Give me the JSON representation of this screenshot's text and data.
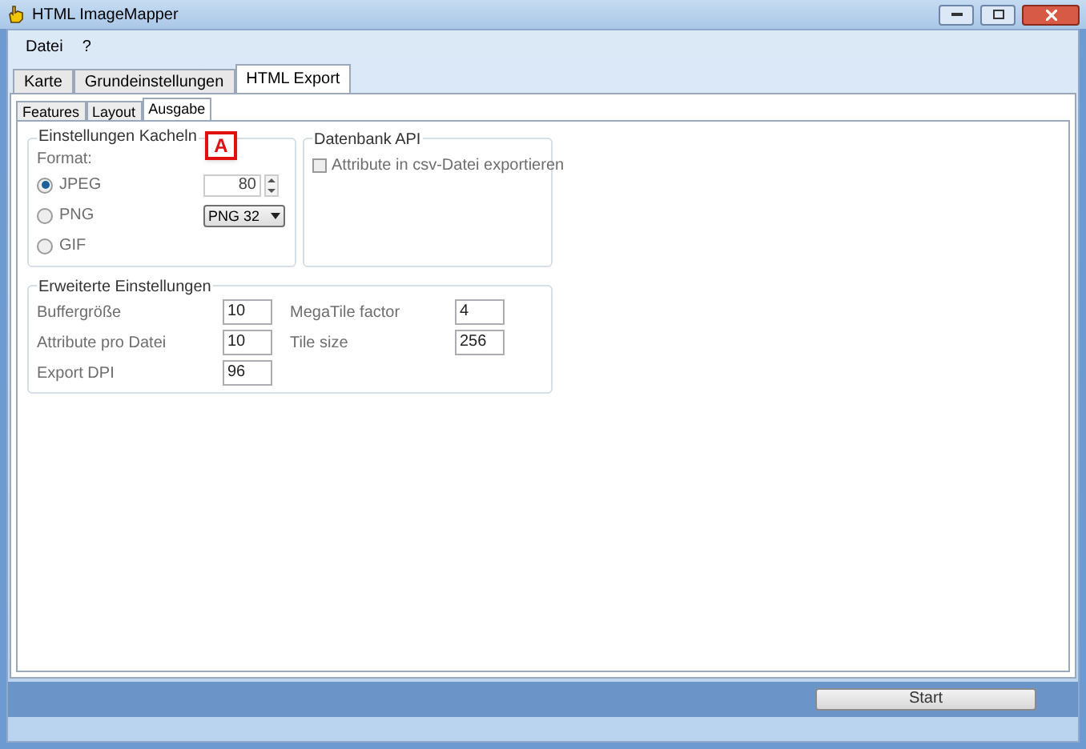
{
  "window": {
    "title": "HTML ImageMapper"
  },
  "menu": [
    "Datei",
    "?"
  ],
  "tabs": [
    {
      "label": "Karte",
      "selected": false
    },
    {
      "label": "Grundeinstellungen",
      "selected": false
    },
    {
      "label": "HTML Export",
      "selected": true
    }
  ],
  "subtabs": [
    {
      "label": "Features",
      "selected": false
    },
    {
      "label": "Layout",
      "selected": false
    },
    {
      "label": "Ausgabe",
      "selected": true
    }
  ],
  "tiles": {
    "title": "Einstellungen Kacheln",
    "badge": "A",
    "format_label": "Format:",
    "formats": [
      {
        "label": "JPEG",
        "selected": true
      },
      {
        "label": "PNG",
        "selected": false
      },
      {
        "label": "GIF",
        "selected": false
      }
    ],
    "jpeg_quality": "80",
    "png_type": "PNG 32"
  },
  "database": {
    "title": "Datenbank API",
    "checkbox": {
      "label": "Attribute in csv-Datei exportieren",
      "checked": false
    }
  },
  "advanced": {
    "title": "Erweiterte Einstellungen",
    "left": [
      {
        "label": "Buffergröße",
        "value": "10"
      },
      {
        "label": "Attribute pro Datei",
        "value": "10"
      },
      {
        "label": "Export DPI",
        "value": "96"
      }
    ],
    "right": [
      {
        "label": "MegaTile factor",
        "value": "4"
      },
      {
        "label": "Tile size",
        "value": "256"
      }
    ]
  },
  "start_button": "Start"
}
